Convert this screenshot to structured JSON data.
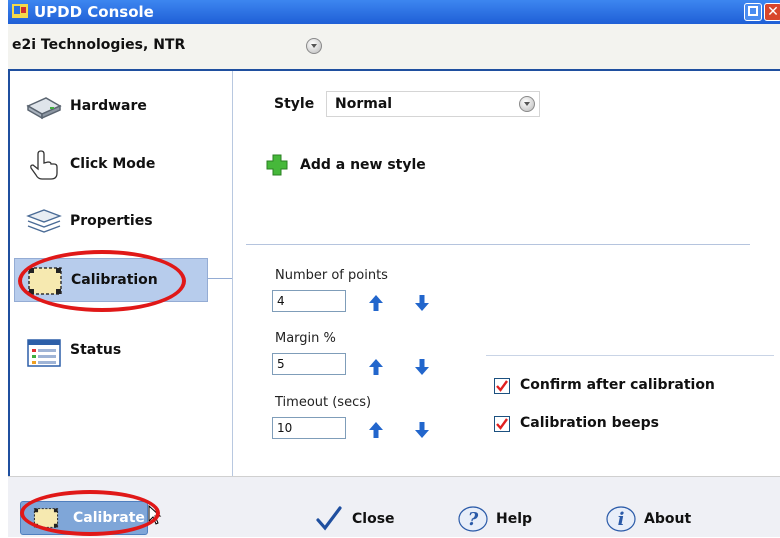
{
  "window": {
    "title": "UPDD Console",
    "restore_icon": "restore-icon",
    "close_glyph": "✕"
  },
  "device": {
    "name": "e2i Technologies, NTR"
  },
  "sidebar": {
    "items": [
      {
        "label": "Hardware",
        "icon": "hardware-icon"
      },
      {
        "label": "Click Mode",
        "icon": "hand-pointer-icon"
      },
      {
        "label": "Properties",
        "icon": "layers-icon"
      },
      {
        "label": "Calibration",
        "icon": "calibration-icon",
        "selected": true
      },
      {
        "label": "Status",
        "icon": "status-icon"
      }
    ]
  },
  "main": {
    "style_label": "Style",
    "style_value": "Normal",
    "add_style_label": "Add a new style",
    "fields": [
      {
        "label": "Number of points",
        "value": "4"
      },
      {
        "label": "Margin %",
        "value": "5"
      },
      {
        "label": "Timeout (secs)",
        "value": "10"
      }
    ],
    "checkboxes": [
      {
        "label": "Confirm after calibration",
        "checked": true
      },
      {
        "label": "Calibration beeps",
        "checked": true
      }
    ]
  },
  "footer": {
    "calibrate": "Calibrate",
    "close": "Close",
    "help": "Help",
    "about": "About"
  },
  "colors": {
    "title_bar": "#2a6fe0",
    "selection": "#b7ccec",
    "highlight_ring": "#e01818",
    "arrow": "#2266cc"
  }
}
